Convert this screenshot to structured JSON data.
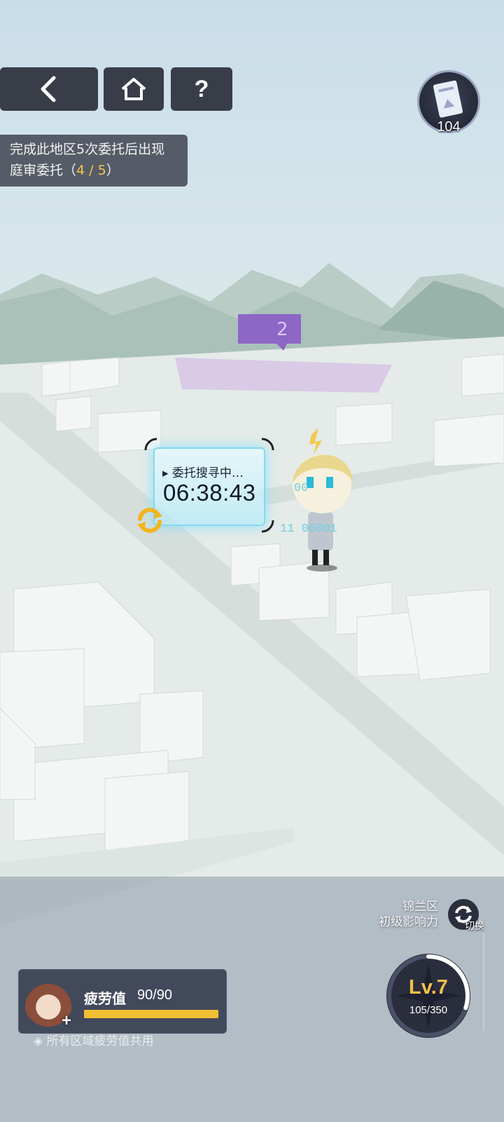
{
  "nav": {
    "back_icon": "chevron-left-icon",
    "home_icon": "home-icon",
    "help_label": "?"
  },
  "hint": {
    "line1": "完成此地区5次委托后出现",
    "line2_prefix": "庭审委托（",
    "progress": "4 / 5",
    "line2_suffix": "）"
  },
  "ticket": {
    "count": "104"
  },
  "search": {
    "label": "▸ 委托搜寻中…",
    "timer": "06:38:43"
  },
  "district": {
    "name": "锦兰区",
    "influence": "初级影响力",
    "switch_label": "切换"
  },
  "level": {
    "label": "Lv.7",
    "xp": "105/350",
    "progress": 0.3
  },
  "fatigue": {
    "label": "疲劳值",
    "value": "90/90",
    "progress": 1.0,
    "note": "所有区域疲劳值共用"
  },
  "colors": {
    "accent": "#f0bf32",
    "panel": "#30364a",
    "marker": "#8a5cc8"
  }
}
